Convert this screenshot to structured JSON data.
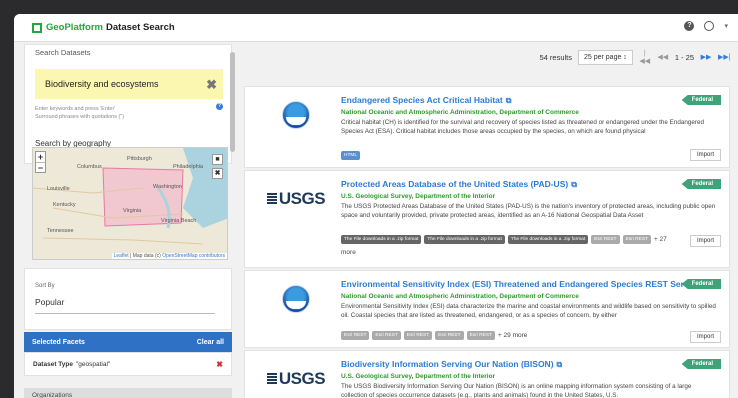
{
  "app": {
    "brand": "GeoPlatform",
    "title": "Dataset Search"
  },
  "topbar": {
    "help": "?",
    "user_caret": "▾"
  },
  "search": {
    "label": "Search Datasets",
    "value": "Biodiversity and ecosystems",
    "clear": "✖",
    "hint1": "Enter keywords and press 'Enter'",
    "hint2": "Surround phrases with quotations (\")",
    "geo_label": "Search by geography"
  },
  "map": {
    "labels": [
      "Columbus",
      "Pittsburgh",
      "Philadelphia",
      "Washington",
      "Louisville",
      "Virginia Beach",
      "Kentucky",
      "Virginia",
      "Tennessee"
    ],
    "attribution_leaflet": "Leaflet",
    "attribution_text": " | Map data (c) ",
    "attribution_osm": "OpenStreetMap contributors"
  },
  "sort": {
    "label": "Sort By",
    "value": "Popular"
  },
  "facets": {
    "title": "Selected Facets",
    "clear": "Clear all",
    "row_key": "Dataset Type",
    "row_value": "\"geospatial\"",
    "remove": "✖"
  },
  "organizations": {
    "title": "Organizations"
  },
  "pager": {
    "count": "54 results",
    "per_page": "25 per page ↕",
    "range": "1 - 25"
  },
  "results": [
    {
      "title": "Endangered Species Act Critical Habitat",
      "publisher": "National Oceanic and Atmospheric Administration, Department of Commerce",
      "desc": "Critical habitat (CH) is identified for the survival and recovery of species listed as threatened or endangered under the Endangered Species Act (ESA). Critical habitat includes those areas occupied by the species, on which are found physical",
      "badge": "Federal",
      "tags": [
        "HTML"
      ],
      "more": "",
      "import": "Import"
    },
    {
      "title": "Protected Areas Database of the United States (PAD-US)",
      "publisher": "U.S. Geological Survey, Department of the Interior",
      "desc": "The USGS Protected Areas Database of the United States (PAD-US) is the nation's inventory of protected areas, including public open space and voluntarily provided, private protected areas, identified as an A-16 National Geospatial Data Asset",
      "badge": "Federal",
      "tags": [
        "The File downloads in a .zip format",
        "The File downloads in a .zip format",
        "The File downloads in a .zip format",
        "Esri REST",
        "Esri REST"
      ],
      "tags_more": "+ 27",
      "more": "more",
      "import": "Import"
    },
    {
      "title": "Environmental Sensitivity Index (ESI) Threatened and Endangered Species REST Services",
      "publisher": "National Oceanic and Atmospheric Administration, Department of Commerce",
      "desc": "Environmental Sensitivity Index (ESI) data characterize the marine and coastal environments and wildlife based on sensitivity to spilled oil. Coastal species that are listed as threatened, endangered, or as a species of concern, by either",
      "badge": "Federal",
      "tags": [
        "Esri REST",
        "Esri REST",
        "Esri REST",
        "Esri REST",
        "Esri REST"
      ],
      "tags_more": "+ 29 more",
      "import": "Import"
    },
    {
      "title": "Biodiversity Information Serving Our Nation (BISON)",
      "publisher": "U.S. Geological Survey, Department of the Interior",
      "desc": "The USGS Biodiversity Information Serving Our Nation (BISON) is an online mapping information system consisting of a large collection of species occurrence datasets (e.g., plants and animals) found in the United States, U.S.",
      "badge": "Federal"
    }
  ],
  "logos": {
    "usgs": "USGS"
  },
  "colors": {
    "accent": "#2b7bd3",
    "publisher": "#2f9a2f",
    "badge": "#3fa37a",
    "highlight": "#fbf7b0",
    "facets": "#2f72c5"
  }
}
